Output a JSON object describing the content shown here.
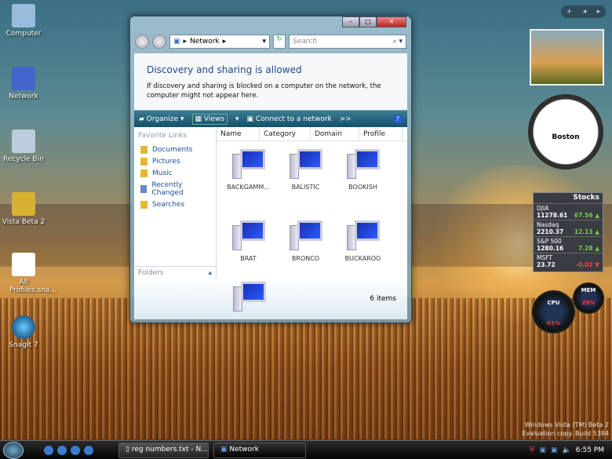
{
  "desktop": {
    "icons": [
      {
        "label": "Computer"
      },
      {
        "label": "Network"
      },
      {
        "label": "Recycle Bin"
      },
      {
        "label": "Vista Beta 2"
      },
      {
        "label": "All Profiles.sna..."
      },
      {
        "label": "SnagIt 7"
      }
    ]
  },
  "window": {
    "address": "Network",
    "search_placeholder": "Search",
    "banner": {
      "title": "Discovery and sharing is allowed",
      "text": "If discovery and sharing is blocked on a computer on the network, the computer might not appear here."
    },
    "toolbar": {
      "organize": "Organize",
      "views": "Views",
      "connect": "Connect to a network",
      "more": ">>"
    },
    "favorite_links_title": "Favorite Links",
    "links": [
      "Documents",
      "Pictures",
      "Music",
      "Recently Changed",
      "Searches"
    ],
    "folders_label": "Folders",
    "columns": [
      "Name",
      "Category",
      "Domain",
      "Profile"
    ],
    "items": [
      "BACKGAMM...",
      "BALISTIC",
      "BOOKISH",
      "BRAT",
      "BRONCO",
      "BUCKAROO"
    ],
    "status": "6 items"
  },
  "gadgets": {
    "clock_city": "Boston",
    "stocks_title": "Stocks",
    "stocks": [
      {
        "sym": "DJIA",
        "price": "11278.61",
        "chg": "67.56",
        "dir": "up"
      },
      {
        "sym": "Nasdaq",
        "price": "2210.37",
        "chg": "12.13",
        "dir": "up"
      },
      {
        "sym": "S&P 500",
        "price": "1280.16",
        "chg": "7.28",
        "dir": "up"
      },
      {
        "sym": "MSFT",
        "price": "23.72",
        "chg": "-0.02",
        "dir": "down"
      }
    ],
    "cpu_label": "CPU",
    "cpu_value": "01%",
    "mem_label": "MEM",
    "mem_value": "28%"
  },
  "watermark": {
    "line1": "Windows Vista (TM) Beta 2",
    "line2": "Evaluation copy. Build 5384"
  },
  "taskbar": {
    "tasks": [
      "reg numbers.txt - N...",
      "Network"
    ],
    "clock": "6:55 PM"
  }
}
